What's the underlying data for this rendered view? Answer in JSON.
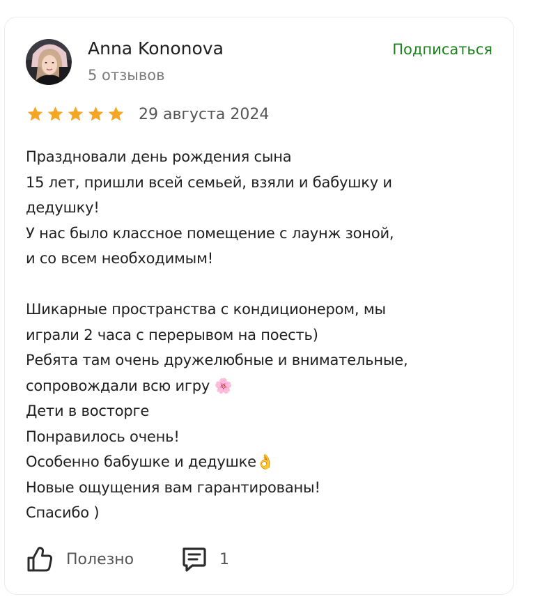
{
  "author": {
    "name": "Anna Kononova",
    "review_count": "5 отзывов"
  },
  "actions": {
    "subscribe_label": "Подписаться"
  },
  "review": {
    "rating": 5,
    "rating_max": 5,
    "date": "29 августа 2024",
    "lines": [
      "Праздновали день рождения сына",
      "15 лет, пришли всей семьей, взяли и бабушку и",
      "дедушку!",
      "У нас было классное помещение с лаунж зоной,",
      "и со всем необходимым!",
      "",
      "Шикарные пространства с кондиционером, мы",
      "играли 2 часа с перерывом на поесть)",
      "Ребята там очень дружелюбные и внимательные,",
      "сопровождали всю игру 🌸",
      "Дети в восторге",
      "Понравилось очень!",
      "Особенно бабушке и дедушке👌",
      "Новые ощущения вам гарантированы!",
      "Спасибо )"
    ]
  },
  "footer": {
    "helpful_label": "Полезно",
    "comment_count": "1"
  },
  "icons": {
    "star": "star-icon",
    "like": "thumbs-up-icon",
    "comment": "comment-icon"
  },
  "colors": {
    "accent_green": "#1a7f1a",
    "star_gold": "#f5a623",
    "text_primary": "#1f1f1f",
    "text_secondary": "#7b7b7b"
  }
}
